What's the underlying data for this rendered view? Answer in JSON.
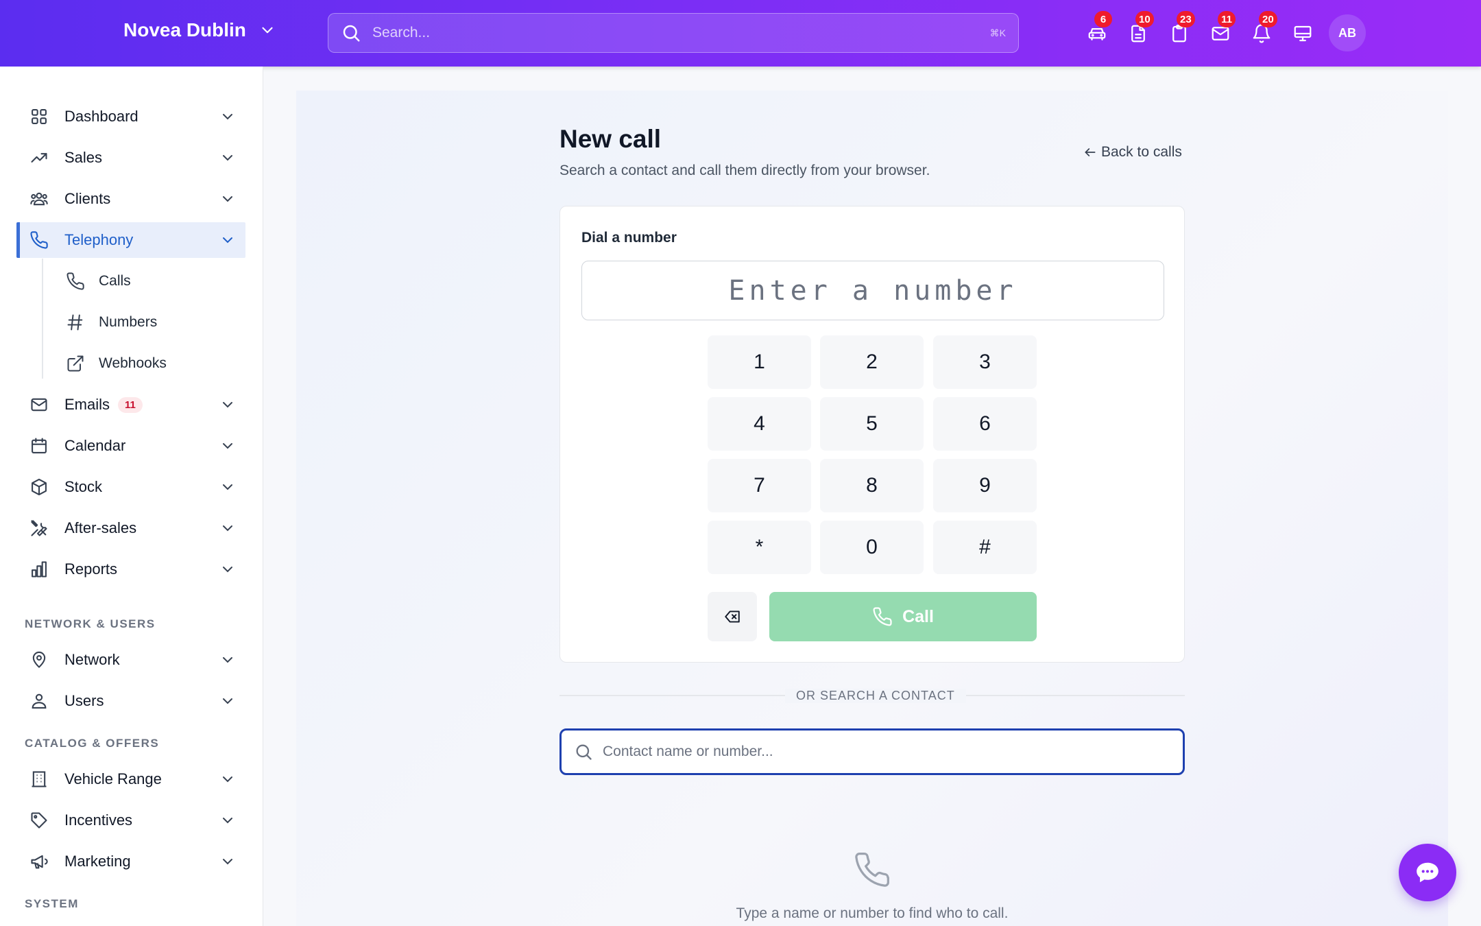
{
  "header": {
    "brand": "Novea Dublin",
    "search_placeholder": "Search...",
    "search_shortcut": "⌘K",
    "icons": [
      {
        "name": "car-icon",
        "badge": "6"
      },
      {
        "name": "document-icon",
        "badge": "10"
      },
      {
        "name": "clipboard-icon",
        "badge": "23"
      },
      {
        "name": "mail-icon",
        "badge": "11"
      },
      {
        "name": "bell-icon",
        "badge": "20"
      },
      {
        "name": "monitor-icon",
        "badge": ""
      }
    ],
    "avatar": "AB"
  },
  "sidebar": {
    "items": [
      {
        "label": "Dashboard",
        "icon": "grid-icon"
      },
      {
        "label": "Sales",
        "icon": "trending-up-icon"
      },
      {
        "label": "Clients",
        "icon": "users-group-icon"
      },
      {
        "label": "Telephony",
        "icon": "phone-icon",
        "active": true
      },
      {
        "label": "Emails",
        "icon": "mail-icon",
        "badge": "11"
      },
      {
        "label": "Calendar",
        "icon": "calendar-icon"
      },
      {
        "label": "Stock",
        "icon": "box-icon"
      },
      {
        "label": "After-sales",
        "icon": "tools-icon"
      },
      {
        "label": "Reports",
        "icon": "bar-chart-icon"
      },
      {
        "label": "Network",
        "icon": "map-pin-icon"
      },
      {
        "label": "Users",
        "icon": "user-icon"
      },
      {
        "label": "Vehicle Range",
        "icon": "building-icon"
      },
      {
        "label": "Incentives",
        "icon": "tag-icon"
      },
      {
        "label": "Marketing",
        "icon": "megaphone-icon"
      }
    ],
    "sub_items": [
      {
        "label": "Calls",
        "icon": "phone-icon"
      },
      {
        "label": "Numbers",
        "icon": "hash-icon"
      },
      {
        "label": "Webhooks",
        "icon": "external-link-icon"
      }
    ],
    "sections": [
      "NETWORK & USERS",
      "CATALOG & OFFERS",
      "SYSTEM"
    ]
  },
  "main": {
    "title": "New call",
    "subtitle": "Search a contact and call them directly from your browser.",
    "back_link": "Back to calls",
    "card_title": "Dial a number",
    "dial_placeholder": "Enter a number",
    "keys": [
      "1",
      "2",
      "3",
      "4",
      "5",
      "6",
      "7",
      "8",
      "9",
      "*",
      "0",
      "#"
    ],
    "call_label": "Call",
    "divider_label": "OR SEARCH A CONTACT",
    "contact_placeholder": "Contact name or number...",
    "empty_text": "Type a name or number to find who to call."
  },
  "colors": {
    "header_start": "#5b2df0",
    "header_end": "#9a2cf7",
    "active_nav": "#1f5fc9",
    "call_button": "#95dbb0",
    "badge": "#ef1b2d",
    "fab": "#8b2cf5"
  }
}
